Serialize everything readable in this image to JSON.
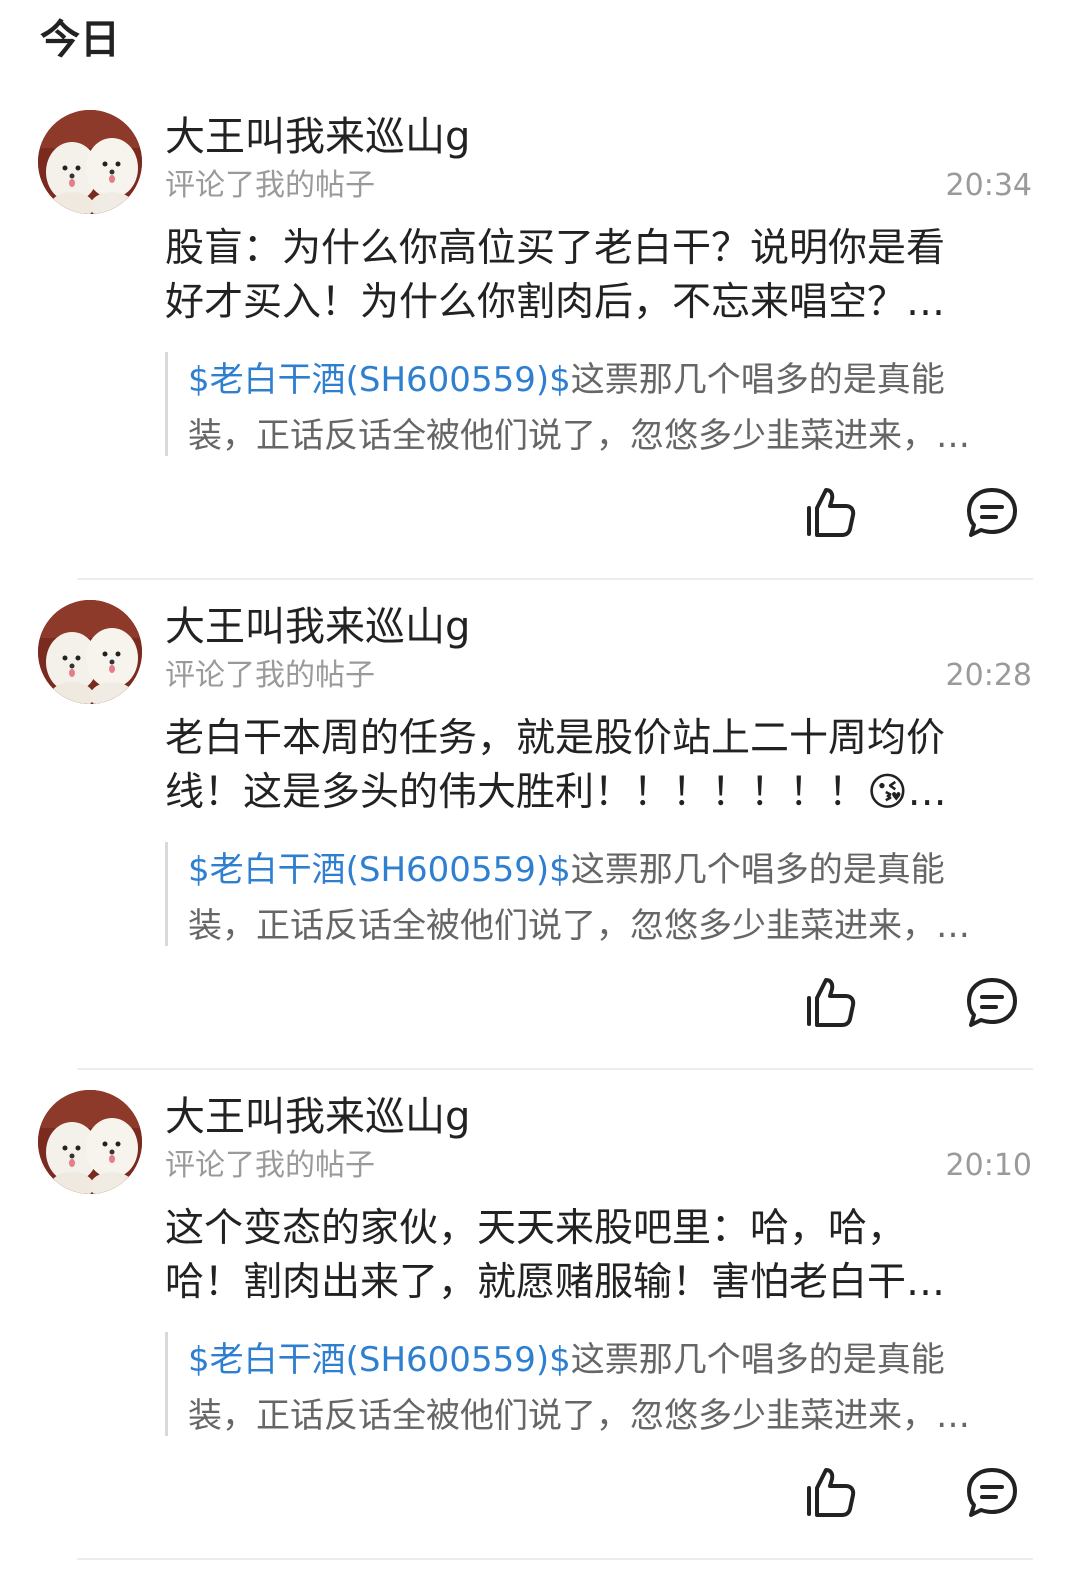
{
  "section": {
    "title": "今日"
  },
  "quote_common": {
    "link": "$老白干酒(SH600559)$",
    "line1_rest": "这票那几个唱多的是真能",
    "line2": "装，正话反话全被他们说了，忽悠多少韭菜进来，…"
  },
  "notifications": [
    {
      "username": "大王叫我来巡山g",
      "action": "评论了我的帖子",
      "time": "20:34",
      "body_line1": "股盲：为什么你高位买了老白干？说明你是看",
      "body_line2": "好才买入！为什么你割肉后，不忘来唱空？…"
    },
    {
      "username": "大王叫我来巡山g",
      "action": "评论了我的帖子",
      "time": "20:28",
      "body_line1": "老白干本周的任务，就是股价站上二十周均价",
      "body_line2": "线！这是多头的伟大胜利！！！！！！！😘…"
    },
    {
      "username": "大王叫我来巡山g",
      "action": "评论了我的帖子",
      "time": "20:10",
      "body_line1": "这个变态的家伙，天天来股吧里：哈，哈，",
      "body_line2": "哈！割肉出来了，就愿赌服输！害怕老白干…"
    }
  ],
  "colors": {
    "link": "#2f7fd0",
    "secondary_text": "#9a9a9a",
    "primary_text": "#222222"
  },
  "icons": {
    "like": "thumbs-up-icon",
    "comment": "comment-bubble-icon"
  }
}
